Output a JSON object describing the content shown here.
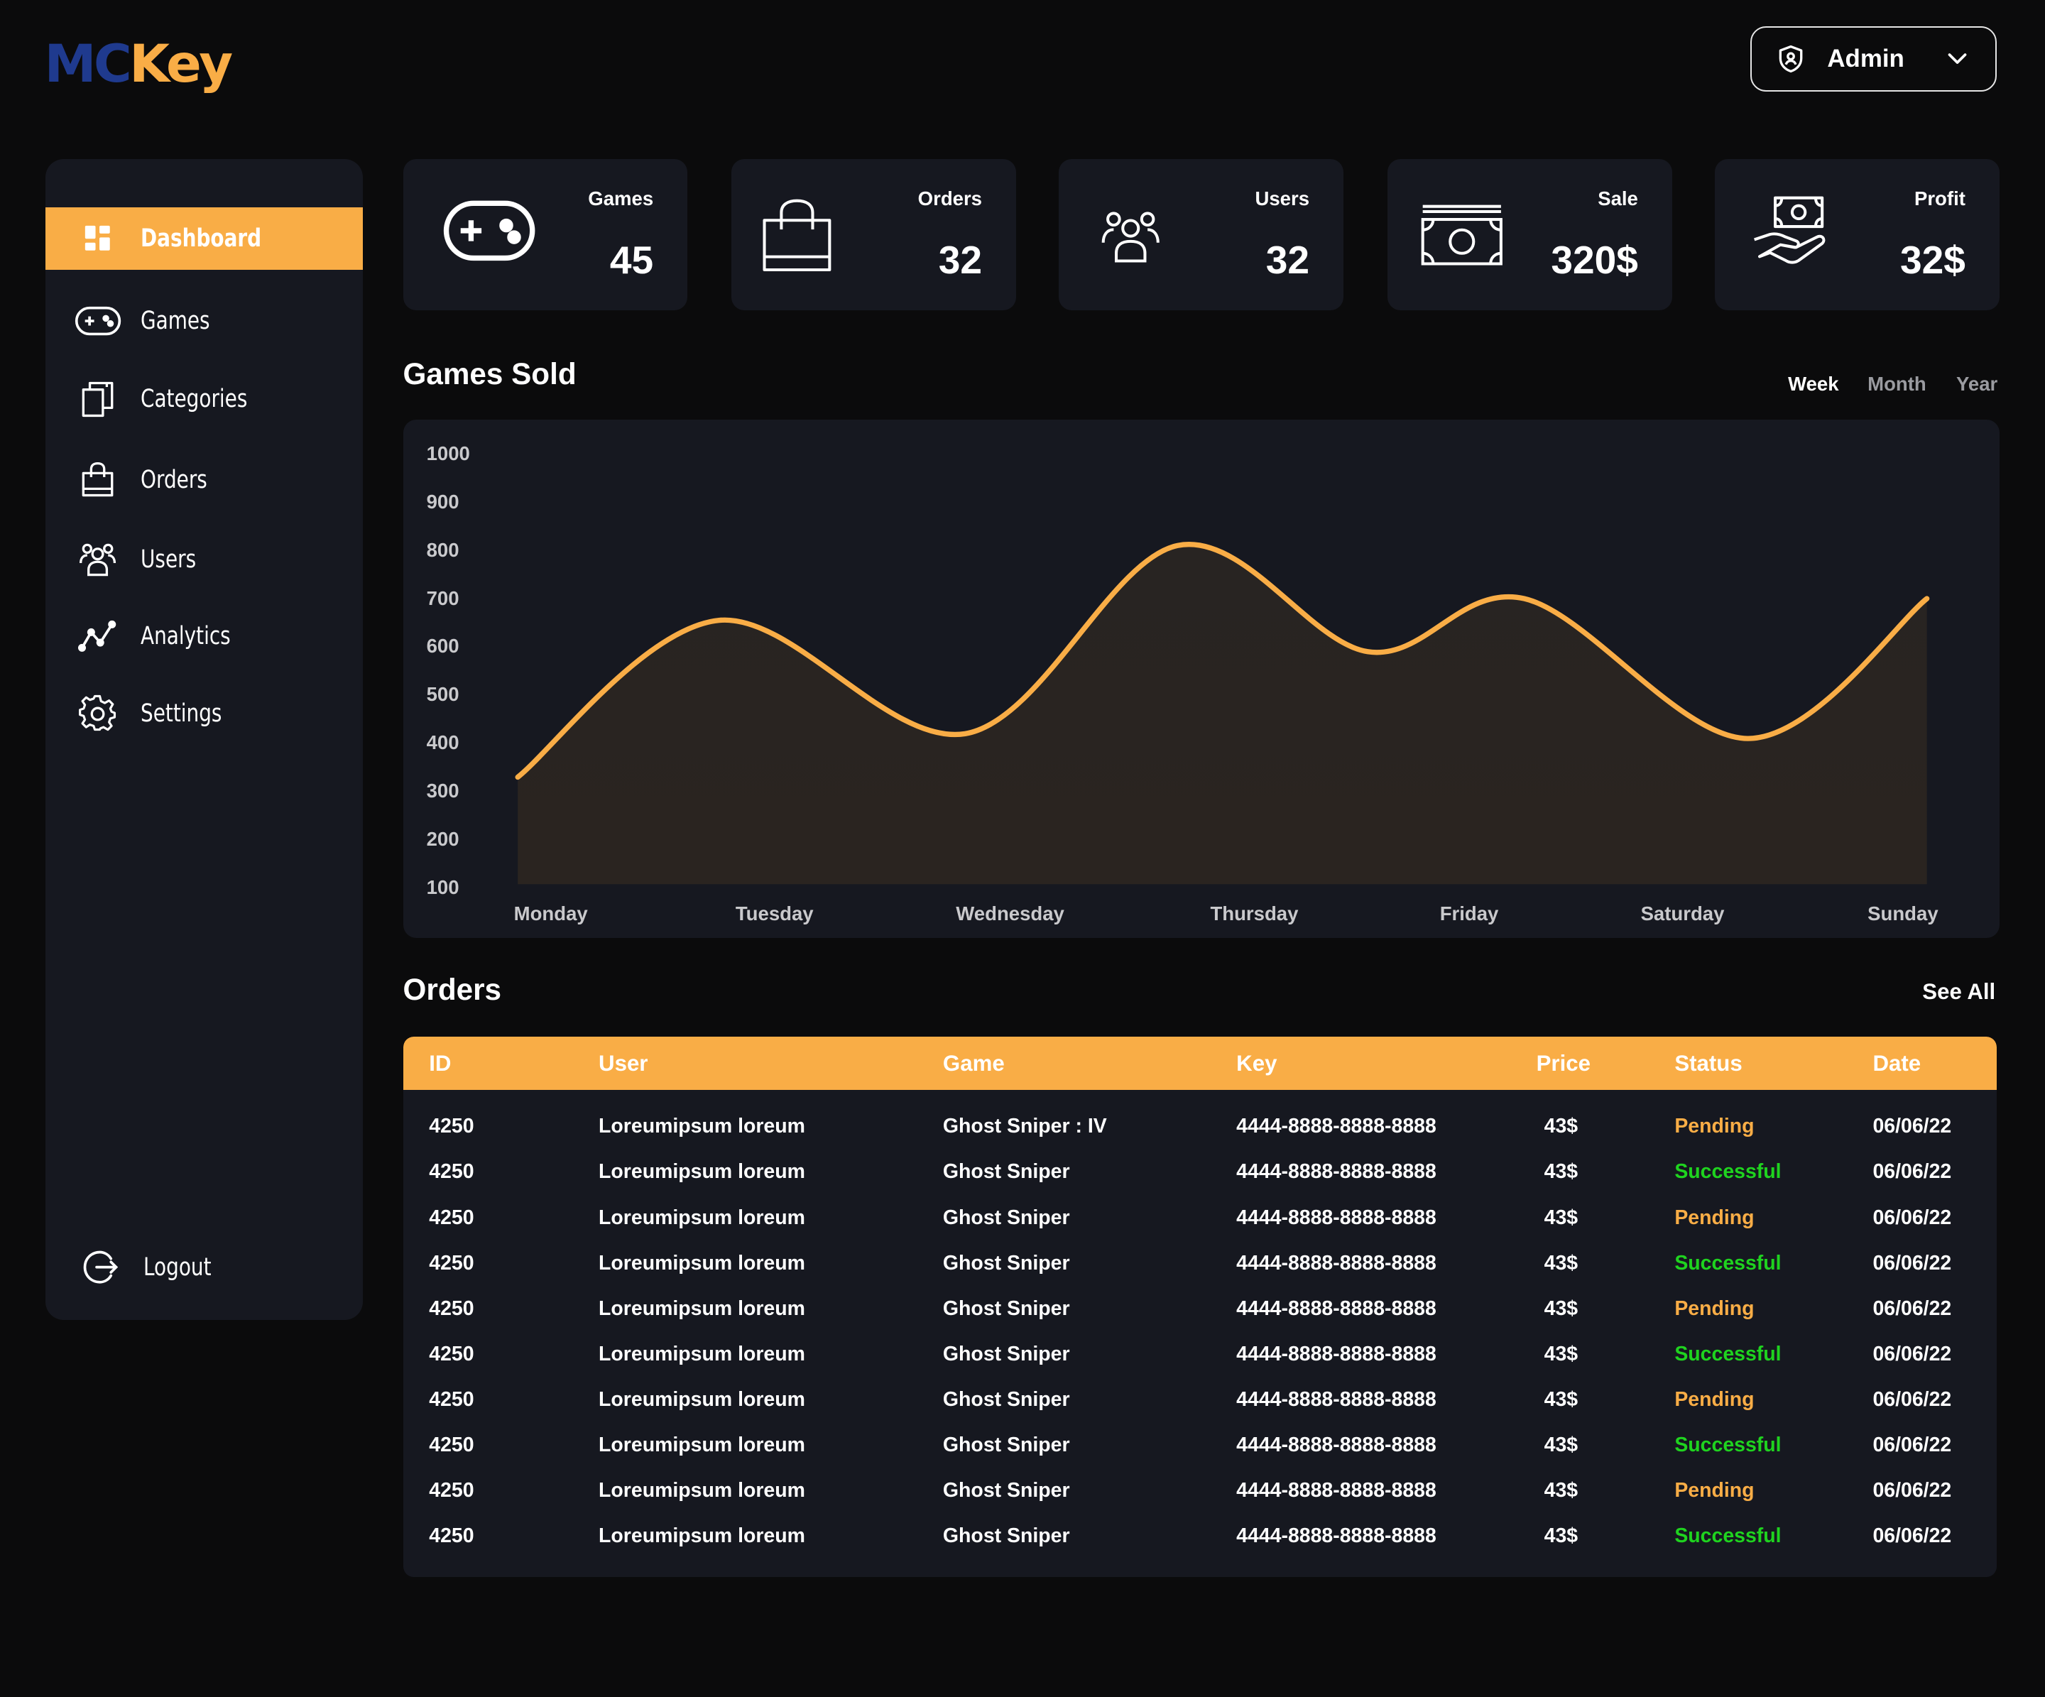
{
  "brand": {
    "logo_mc": "MC",
    "logo_key": "Key"
  },
  "header": {
    "admin_label": "Admin"
  },
  "sidebar": {
    "items": [
      {
        "label": "Dashboard",
        "icon": "dashboard-icon",
        "active": true
      },
      {
        "label": "Games",
        "icon": "gamepad-icon"
      },
      {
        "label": "Categories",
        "icon": "categories-icon"
      },
      {
        "label": "Orders",
        "icon": "shopping-bag-icon"
      },
      {
        "label": "Users",
        "icon": "users-icon"
      },
      {
        "label": "Analytics",
        "icon": "analytics-icon"
      },
      {
        "label": "Settings",
        "icon": "gear-icon"
      }
    ],
    "logout_label": "Logout"
  },
  "stats": [
    {
      "title": "Games",
      "value": "45",
      "icon": "gamepad-icon"
    },
    {
      "title": "Orders",
      "value": "32",
      "icon": "shopping-bag-icon"
    },
    {
      "title": "Users",
      "value": "32",
      "icon": "users-icon"
    },
    {
      "title": "Sale",
      "value": "320$",
      "icon": "banknote-icon"
    },
    {
      "title": "Profit",
      "value": "32$",
      "icon": "money-hand-icon"
    }
  ],
  "games_sold": {
    "title": "Games Sold",
    "ranges": [
      "Week",
      "Month",
      "Year"
    ],
    "selected_range": "Week"
  },
  "chart_data": {
    "type": "area",
    "categories": [
      "Monday",
      "Tuesday",
      "Wednesday",
      "Thursday",
      "Friday",
      "Saturday",
      "Sunday"
    ],
    "y_ticks": [
      "1000",
      "900",
      "800",
      "700",
      "600",
      "500",
      "400",
      "300",
      "200",
      "100"
    ],
    "ylim": [
      100,
      1000
    ],
    "series": [
      {
        "values": [
          330,
          655,
          420,
          810,
          590,
          700,
          410,
          700
        ],
        "x_positions": [
          0,
          0.9,
          2.0,
          2.95,
          3.8,
          4.5,
          5.5,
          6.3
        ]
      }
    ],
    "line_color": "#f9ad46",
    "grid": false
  },
  "orders": {
    "title": "Orders",
    "see_all_label": "See All",
    "columns": [
      "ID",
      "User",
      "Game",
      "Key",
      "Price",
      "Status",
      "Date"
    ],
    "rows": [
      {
        "id": "4250",
        "user": "Loreumipsum loreum",
        "game": "Ghost Sniper : IV",
        "key": "4444-8888-8888-8888",
        "price": "43$",
        "status": "Pending",
        "date": "06/06/22"
      },
      {
        "id": "4250",
        "user": "Loreumipsum loreum",
        "game": "Ghost Sniper",
        "key": "4444-8888-8888-8888",
        "price": "43$",
        "status": "Successful",
        "date": "06/06/22"
      },
      {
        "id": "4250",
        "user": "Loreumipsum loreum",
        "game": "Ghost Sniper",
        "key": "4444-8888-8888-8888",
        "price": "43$",
        "status": "Pending",
        "date": "06/06/22"
      },
      {
        "id": "4250",
        "user": "Loreumipsum loreum",
        "game": "Ghost Sniper",
        "key": "4444-8888-8888-8888",
        "price": "43$",
        "status": "Successful",
        "date": "06/06/22"
      },
      {
        "id": "4250",
        "user": "Loreumipsum loreum",
        "game": "Ghost Sniper",
        "key": "4444-8888-8888-8888",
        "price": "43$",
        "status": "Pending",
        "date": "06/06/22"
      },
      {
        "id": "4250",
        "user": "Loreumipsum loreum",
        "game": "Ghost Sniper",
        "key": "4444-8888-8888-8888",
        "price": "43$",
        "status": "Successful",
        "date": "06/06/22"
      },
      {
        "id": "4250",
        "user": "Loreumipsum loreum",
        "game": "Ghost Sniper",
        "key": "4444-8888-8888-8888",
        "price": "43$",
        "status": "Pending",
        "date": "06/06/22"
      },
      {
        "id": "4250",
        "user": "Loreumipsum loreum",
        "game": "Ghost Sniper",
        "key": "4444-8888-8888-8888",
        "price": "43$",
        "status": "Successful",
        "date": "06/06/22"
      },
      {
        "id": "4250",
        "user": "Loreumipsum loreum",
        "game": "Ghost Sniper",
        "key": "4444-8888-8888-8888",
        "price": "43$",
        "status": "Pending",
        "date": "06/06/22"
      },
      {
        "id": "4250",
        "user": "Loreumipsum loreum",
        "game": "Ghost Sniper",
        "key": "4444-8888-8888-8888",
        "price": "43$",
        "status": "Successful",
        "date": "06/06/22"
      }
    ]
  },
  "colors": {
    "accent": "#f9ad46",
    "panel": "#161820",
    "background": "#0b0b0c",
    "success": "#1fd31f",
    "logo_blue": "#1f3a8e"
  }
}
